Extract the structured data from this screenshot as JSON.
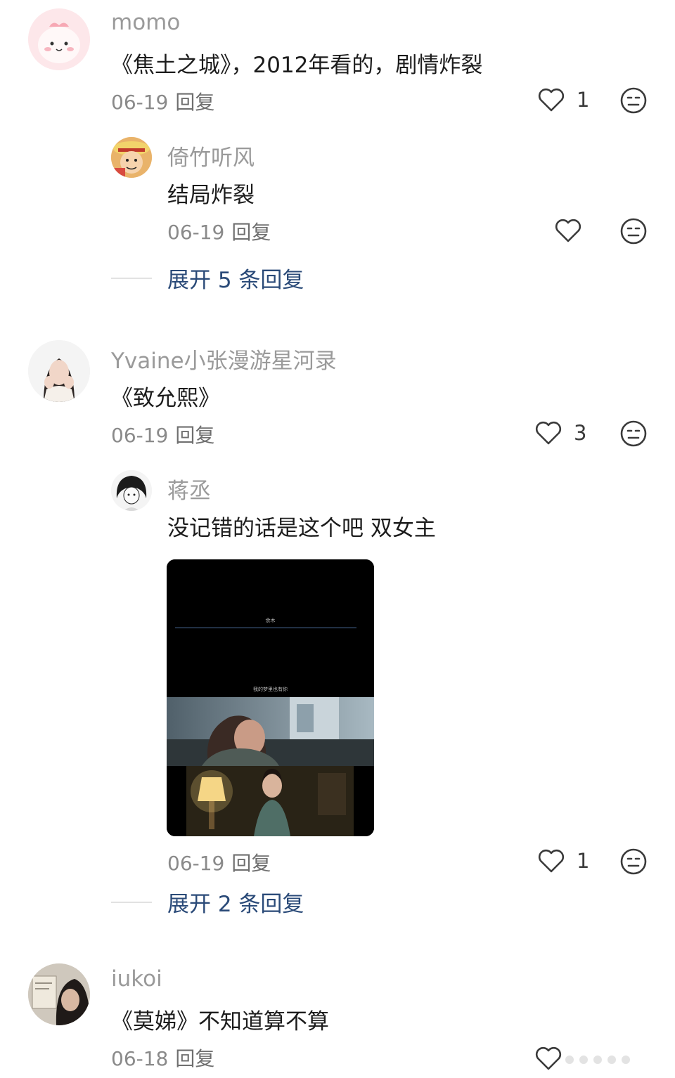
{
  "threads": [
    {
      "user": "momo",
      "text": "《焦土之城》，2012年看的，剧情炸裂",
      "date": "06-19",
      "reply_label": "回复",
      "likes": "1",
      "replies": [
        {
          "user": "倚竹听风",
          "text": "结局炸裂",
          "date": "06-19",
          "reply_label": "回复",
          "likes": ""
        }
      ],
      "expand_label": "展开 5 条回复"
    },
    {
      "user": "Yvaine小张漫游星河录",
      "text": "《致允熙》",
      "date": "06-19",
      "reply_label": "回复",
      "likes": "3",
      "replies": [
        {
          "user": "蒋丞",
          "text": "没记错的话是这个吧 双女主",
          "video": {
            "caption_top": "余木",
            "caption_mid": "我的梦里也有你"
          },
          "date": "06-19",
          "reply_label": "回复",
          "likes": "1"
        }
      ],
      "expand_label": "展开 2 条回复"
    },
    {
      "user": "iukoi",
      "text": "《莫娣》不知道算不算",
      "date": "06-18",
      "reply_label": "回复",
      "likes": ""
    }
  ],
  "icons": {
    "like": "heart-outline-icon",
    "dislike": "meh-face-icon"
  },
  "colors": {
    "expand_link": "#2a4a78",
    "username": "#9a9a9a"
  }
}
